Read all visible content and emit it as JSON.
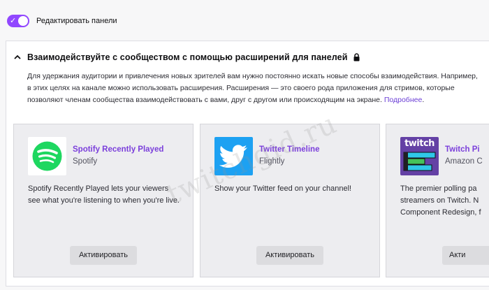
{
  "toggle": {
    "label": "Редактировать панели",
    "state": "on",
    "color": "#9147ff"
  },
  "panel": {
    "title": "Взаимодействуйте с сообществом с помощью расширений для панелей",
    "description": "Для удержания аудитории и привлечения новых зрителей вам нужно постоянно искать новые способы взаимодействия. Например, в этих целях на канале можно использовать расширения. Расширения — это своего рода приложения для стримов, которые позволяют членам сообщества взаимодействовать с вами, друг с другом или происходящим на экране.",
    "more_link": "Подробнее",
    "more_suffix": "."
  },
  "cards": [
    {
      "name": "Spotify Recently Played",
      "vendor": "Spotify",
      "description": "Spotify Recently Played lets your viewers see what you're listening to when you're live.",
      "button": "Активировать",
      "icon": "spotify-logo",
      "icon_color": "#1ed760"
    },
    {
      "name": "Twitter Timeline",
      "vendor": "Flightly",
      "description": "Show your Twitter feed on your channel!",
      "button": "Активировать",
      "icon": "twitter-bird-logo",
      "icon_color": "#1da1f2"
    },
    {
      "name": "Twitch Pi",
      "vendor": "Amazon C",
      "description": "The premier polling pa streamers on Twitch. N Component Redesign, f",
      "button": "Акти",
      "icon": "twitch-poll-logo",
      "icon_color": "#6441a5",
      "logo_text": "twitch"
    }
  ],
  "watermark": "twitchgid.ru",
  "accent_color": "#9147ff",
  "link_color": "#7b3fdb"
}
